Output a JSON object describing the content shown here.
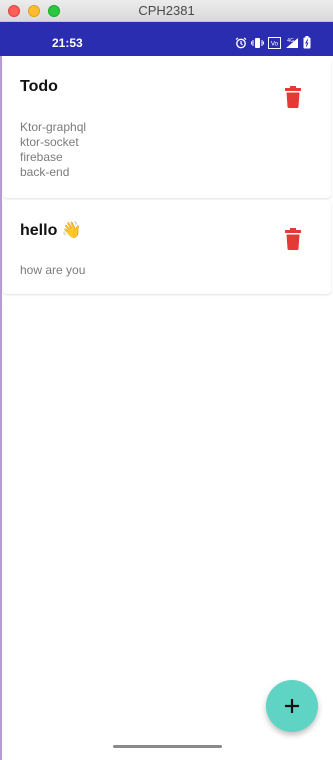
{
  "window": {
    "title": "CPH2381"
  },
  "statusbar": {
    "time": "21:53",
    "icons": [
      "alarm-icon",
      "vibrate-icon",
      "volte-icon",
      "signal-4g-icon",
      "battery-icon"
    ]
  },
  "notes": [
    {
      "title": "Todo",
      "body": "Ktor-graphql\nktor-socket\nfirebase\nback-end",
      "delete_icon": "trash-icon"
    },
    {
      "title": "hello 👋",
      "body": "how are you",
      "delete_icon": "trash-icon"
    }
  ],
  "fab": {
    "icon": "plus-icon",
    "color": "#5fd4c4"
  },
  "colors": {
    "statusbar": "#2b2db0",
    "delete": "#e53935",
    "fab": "#5fd4c4"
  }
}
